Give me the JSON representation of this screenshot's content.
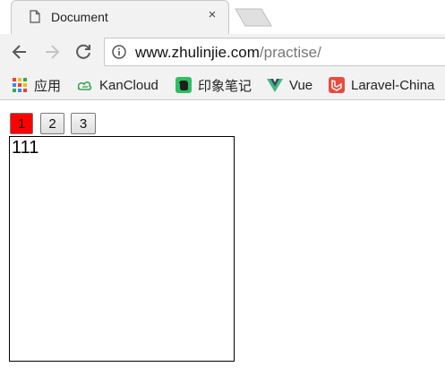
{
  "browser": {
    "tab": {
      "title": "Document",
      "close_glyph": "×",
      "icon": "document-icon"
    },
    "toolbar": {
      "back_icon": "arrow-left-icon",
      "forward_icon": "arrow-right-icon",
      "reload_icon": "reload-icon",
      "url_host": "www.zhulinjie.com",
      "url_path": "/practise/"
    },
    "bookmarks": [
      {
        "label": "应用",
        "icon": "apps-grid-icon"
      },
      {
        "label": "KanCloud",
        "icon": "kancloud-icon"
      },
      {
        "label": "印象笔记",
        "icon": "evernote-icon"
      },
      {
        "label": "Vue",
        "icon": "vue-icon"
      },
      {
        "label": "Laravel-China",
        "icon": "laravel-icon"
      }
    ]
  },
  "page": {
    "tabs": [
      {
        "label": "1",
        "active": true
      },
      {
        "label": "2",
        "active": false
      },
      {
        "label": "3",
        "active": false
      }
    ],
    "active_color": "#ff0000",
    "panel_text": "111"
  }
}
